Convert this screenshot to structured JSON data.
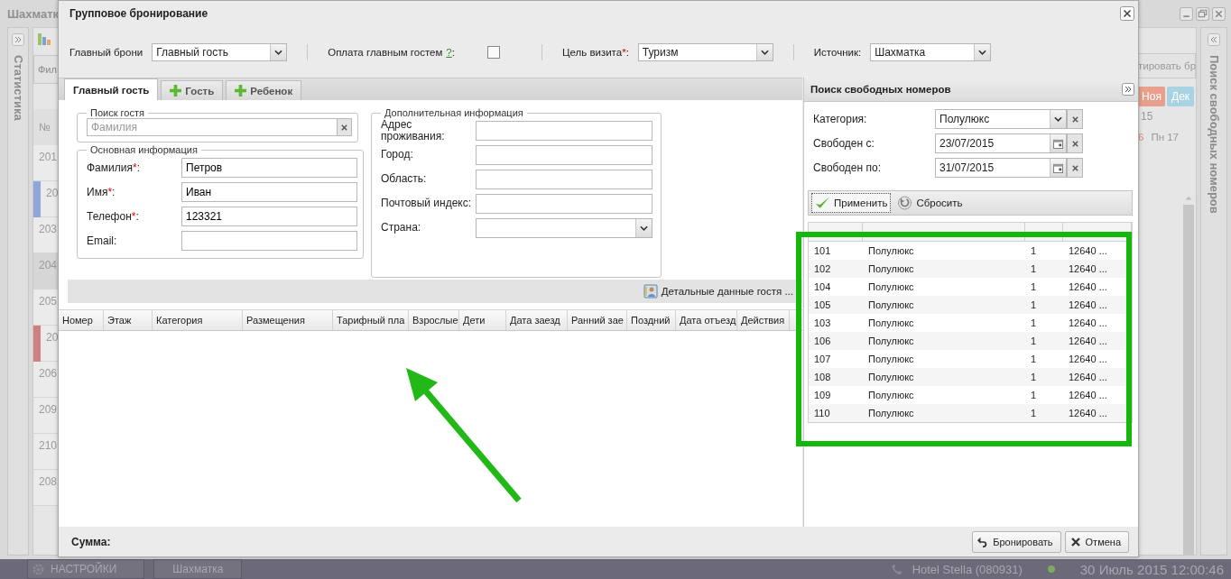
{
  "background_app": {
    "title": "Шахматк",
    "left_panel_title": "Статистика",
    "filter_label": "Фил",
    "room_header": "№",
    "rooms": [
      {
        "number": "201",
        "selected": false
      },
      {
        "number": "20",
        "color": "#8ea6d9",
        "selected": false
      },
      {
        "number": "203",
        "selected": false
      },
      {
        "number": "204",
        "selected": true
      },
      {
        "number": "205",
        "selected": false
      },
      {
        "number": "20",
        "color": "#cf8080",
        "selected": false
      },
      {
        "number": "206",
        "selected": false
      },
      {
        "number": "209",
        "selected": false
      },
      {
        "number": "210",
        "selected": false
      },
      {
        "number": "208",
        "selected": false
      }
    ],
    "export_button": "тировать бр",
    "months": [
      {
        "label": "Ноя",
        "color": "#e8a08c"
      },
      {
        "label": "Дек",
        "color": "#a9d3e3"
      }
    ],
    "year": "15",
    "days": [
      {
        "label": "6",
        "weekend": true
      },
      {
        "label": "Пн 17",
        "weekend": false
      }
    ],
    "right_panel_title": "Поиск свободных номеров"
  },
  "dialog": {
    "title": "Групповое бронирование",
    "toolbar": [
      {
        "kind": "select",
        "label": "Главный брони",
        "value": "Главный гость"
      },
      {
        "kind": "checkbox",
        "label": "Оплата главным гостем",
        "help": "?",
        "colon": ":",
        "checked": false
      },
      {
        "kind": "select",
        "label": "Цель визита",
        "mark": "*",
        "colon": ":",
        "value": "Туризм"
      },
      {
        "kind": "select",
        "label": "Источник:",
        "value": "Шахматка"
      }
    ],
    "tabs": [
      {
        "label": "Главный гость",
        "add": false,
        "selected": true
      },
      {
        "label": "Гость",
        "add": true,
        "selected": false
      },
      {
        "label": "Ребенок",
        "add": true,
        "selected": false
      }
    ],
    "guest_search": {
      "title": "Поиск гостя",
      "placeholder": "Фамилия"
    },
    "main_info": {
      "title": "Основная информация",
      "fields": [
        {
          "label": "Фамилия",
          "mark": "*",
          "colon": ":",
          "value": "Петров"
        },
        {
          "label": "Имя",
          "mark": "*",
          "colon": ":",
          "value": "Иван"
        },
        {
          "label": "Телефон",
          "mark": "*",
          "colon": ":",
          "value": "123321"
        },
        {
          "label": "Email:"
        }
      ]
    },
    "extra_info": {
      "title": "Дополнительная информация",
      "fields": [
        {
          "kind": "text",
          "label": "Адрес проживания:"
        },
        {
          "kind": "text",
          "label": "Город:"
        },
        {
          "kind": "text",
          "label": "Область:"
        },
        {
          "kind": "text",
          "label": "Почтовый индекс:"
        },
        {
          "kind": "select",
          "label": "Страна:"
        }
      ]
    },
    "details_button": "Детальные данные гостя ...",
    "rooms_table": {
      "columns": [
        "Номер",
        "Этаж",
        "Категория",
        "Размещения",
        "Тарифный пла",
        "Взрослые",
        "Дети",
        "Дата заезд",
        "Ранний зае",
        "Поздний",
        "Дата отъезд",
        "Действия"
      ]
    },
    "search_panel": {
      "title": "Поиск свободных номеров",
      "filters": [
        {
          "kind": "select",
          "label": "Категория:",
          "value": "Полулюкс"
        },
        {
          "kind": "date",
          "label": "Свободен с:",
          "value": "23/07/2015"
        },
        {
          "kind": "date",
          "label": "Свободен по:",
          "value": "31/07/2015"
        }
      ],
      "apply_button": "Применить",
      "reset_button": "Сбросить",
      "results": [
        [
          "101",
          "Полулюкс",
          "1",
          "12640 ..."
        ],
        [
          "102",
          "Полулюкс",
          "1",
          "12640 ..."
        ],
        [
          "104",
          "Полулюкс",
          "1",
          "12640 ..."
        ],
        [
          "105",
          "Полулюкс",
          "1",
          "12640 ..."
        ],
        [
          "103",
          "Полулюкс",
          "1",
          "12640 ..."
        ],
        [
          "106",
          "Полулюкс",
          "1",
          "12640 ..."
        ],
        [
          "107",
          "Полулюкс",
          "1",
          "12640 ..."
        ],
        [
          "108",
          "Полулюкс",
          "1",
          "12640 ..."
        ],
        [
          "109",
          "Полулюкс",
          "1",
          "12640 ..."
        ],
        [
          "110",
          "Полулюкс",
          "1",
          "12640 ..."
        ]
      ]
    },
    "total_label": "Сумма:",
    "book_button": "Бронировать",
    "cancel_button": "Отмена"
  },
  "taskbar": {
    "settings": "НАСТРОЙКИ",
    "window": "Шахматка",
    "hotel": "Hotel Stella (080931)",
    "datetime": "30 Июль 2015 12:00:46"
  }
}
